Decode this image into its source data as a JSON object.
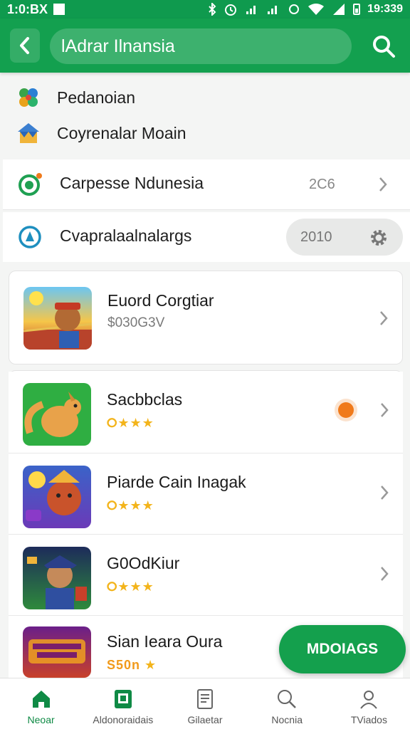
{
  "status_bar": {
    "time_left": "1:0:BX",
    "time_right": "19:339"
  },
  "app_bar": {
    "search_value": "lAdrar Ilnansia"
  },
  "menu": [
    {
      "label": "Pedanoian",
      "icon": "puzzle-icon"
    },
    {
      "label": "Coyrenalar Moain",
      "icon": "house-icon"
    }
  ],
  "settings": [
    {
      "label": "Carpesse Ndunesia",
      "value": "2C6",
      "icon": "circle-badge-icon"
    },
    {
      "label": "Cvapralaalnalargs",
      "value": "2010",
      "icon": "compass-icon"
    }
  ],
  "featured": {
    "title": "Euord Corgtiar",
    "subtitle": "$030G3V"
  },
  "apps": [
    {
      "title": "Sacbbclas",
      "rating_text": "⭘★★★"
    },
    {
      "title": "Piarde Cain Inagak",
      "rating_text": "⭘★★★"
    },
    {
      "title": "G0OdKiur",
      "rating_text": "⭘★★★"
    },
    {
      "title": "Sian Ieara Oura",
      "price": "S50n"
    }
  ],
  "fab_label": "MDOIAGS",
  "bottom_nav": [
    {
      "label": "Neoar",
      "icon": "home-icon",
      "active": true
    },
    {
      "label": "Aldonoraidais",
      "icon": "tablet-icon"
    },
    {
      "label": "Gilaetar",
      "icon": "document-icon"
    },
    {
      "label": "Nocnia",
      "icon": "magnifier-icon"
    },
    {
      "label": "TViados",
      "icon": "person-icon"
    }
  ],
  "colors": {
    "primary": "#13a04f",
    "status": "#0f9a4e",
    "accent_orange": "#f07a1b",
    "star": "#f3b41b"
  }
}
